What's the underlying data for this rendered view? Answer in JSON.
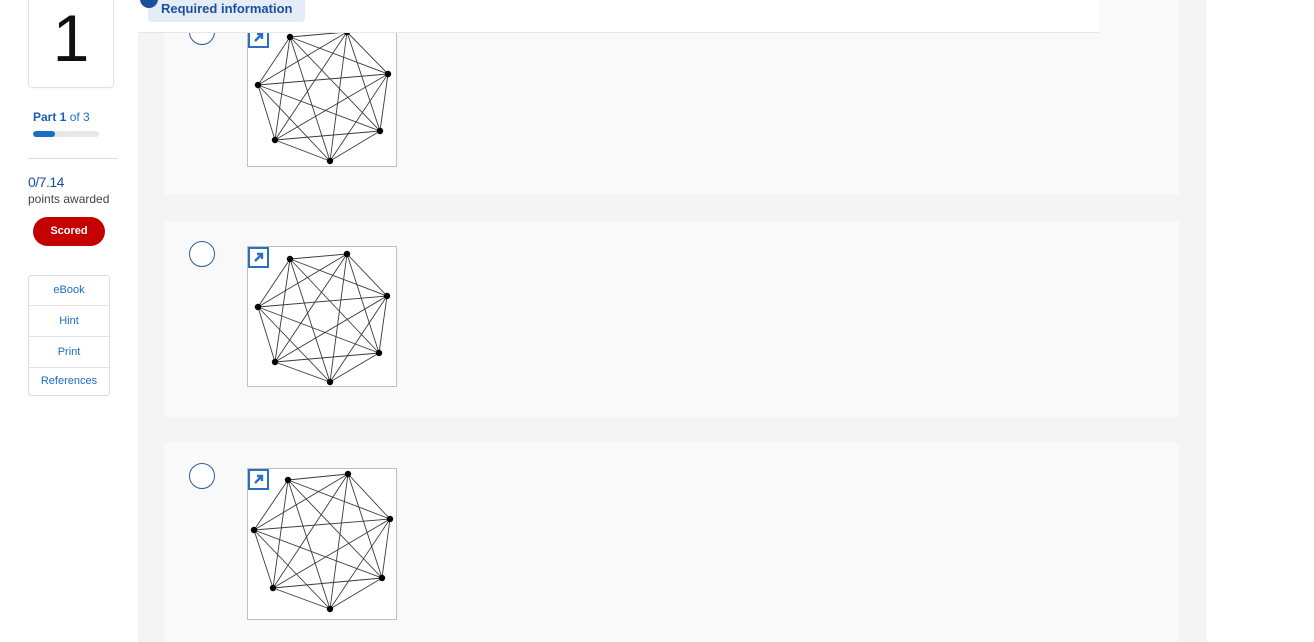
{
  "question": {
    "number": "1"
  },
  "part": {
    "current": "Part 1",
    "total": "of 3",
    "progress": 0.33
  },
  "score": {
    "value": "0/7.14",
    "caption": "points awarded",
    "badge": "Scored"
  },
  "tools": [
    {
      "label": "eBook"
    },
    {
      "label": "Hint"
    },
    {
      "label": "Print"
    },
    {
      "label": "References"
    }
  ],
  "header": {
    "required_label": "Required information"
  },
  "colors": {
    "accent": "#1b6ec2",
    "badge": "#c40000",
    "radio_border": "#2a5d9f"
  },
  "options": [
    {
      "icon": "expand-icon",
      "graph": "complete-graph-7-vertices"
    },
    {
      "icon": "expand-icon",
      "graph": "complete-graph-7-vertices"
    },
    {
      "icon": "expand-icon",
      "graph": "complete-graph-7-vertices"
    }
  ]
}
